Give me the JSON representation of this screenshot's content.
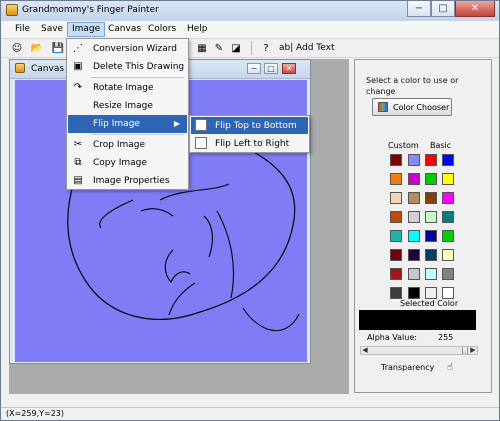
{
  "window": {
    "title": "Grandmommy's Finger Painter",
    "controls": [
      "−",
      "□",
      "✕"
    ]
  },
  "menubar": [
    {
      "label": "File"
    },
    {
      "label": "Save"
    },
    {
      "label": "Image"
    },
    {
      "label": "Canvas"
    },
    {
      "label": "Colors"
    },
    {
      "label": "Help"
    }
  ],
  "toolbar": {
    "add_text": "Add Text",
    "text_icon_label": "ab|"
  },
  "canvas_window": {
    "title": "Canvas 1",
    "background": "#7f7cf6"
  },
  "image_menu": {
    "items": [
      {
        "label": "Conversion Wizard",
        "icon": "wand-icon"
      },
      {
        "label": "Delete This Drawing",
        "icon": "delete-drawing-icon"
      },
      {
        "label": "Rotate Image",
        "icon": "rotate-icon"
      },
      {
        "label": "Resize Image",
        "icon": ""
      },
      {
        "label": "Flip Image",
        "icon": "",
        "has_submenu": true
      },
      {
        "label": "Crop Image",
        "icon": "crop-icon"
      },
      {
        "label": "Copy Image",
        "icon": "copy-icon"
      },
      {
        "label": "Image Properties",
        "icon": "properties-icon"
      }
    ],
    "submenu": [
      {
        "label": "Flip Top to Bottom"
      },
      {
        "label": "Flip Left to Right"
      }
    ]
  },
  "color_panel": {
    "help_text": "Select a color to use or change",
    "chooser_button": "Color Chooser",
    "custom_label": "Custom",
    "basic_label": "Basic",
    "custom_colors": [
      "#7f0000",
      "#f07f0a",
      "#f3d6b3",
      "#be4a07",
      "#18b5ab",
      "#700010",
      "#a01515",
      "#3d3d3d"
    ],
    "palette_colors": [
      [
        "#8888ff",
        "#ff0000",
        "#0000ff"
      ],
      [
        "#cc00cc",
        "#00cc00",
        "#ffff00"
      ],
      [
        "#b38b5d",
        "#7f4000",
        "#ff00ff"
      ],
      [
        "#d0d0d0",
        "#c8ffc8",
        "#008080"
      ],
      [
        "#00ffff",
        "#0000a0",
        "#00d000"
      ],
      [
        "#1e003c",
        "#004060",
        "#ffffc0"
      ],
      [
        "#c8c8c8",
        "#c0ffff",
        "#808080"
      ],
      [
        "#000000",
        "#f0f0f0",
        "#ffffff"
      ]
    ],
    "selected_label": "Selected Color",
    "selected_color": "#000000",
    "alpha_label": "Alpha Value:",
    "alpha_value": "255",
    "transparency_label": "Transparency"
  },
  "status": {
    "coords": "(X=259,Y=23)"
  }
}
